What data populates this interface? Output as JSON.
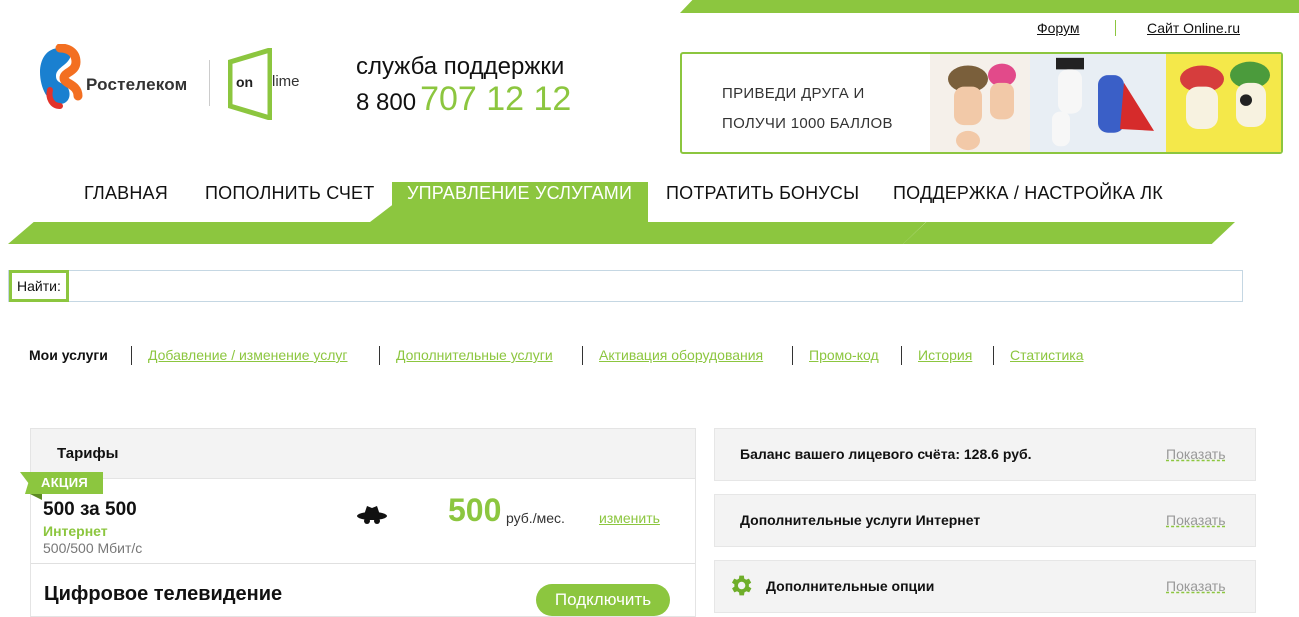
{
  "header": {
    "links": [
      "Форум",
      "Сайт Online.ru"
    ],
    "brand": "Ростелеком",
    "brand2_on": "on",
    "brand2_lime": "lime",
    "support_label": "служба поддержки",
    "phone_prefix": "8 800",
    "phone_main": "707 12 12"
  },
  "banner": {
    "line1": "ПРИВЕДИ ДРУГА И",
    "line2": "ПОЛУЧИ 1000 БАЛЛОВ"
  },
  "nav": {
    "items": [
      "ГЛАВНАЯ",
      "ПОПОЛНИТЬ СЧЕТ",
      "УПРАВЛЕНИЕ УСЛУГАМИ",
      "ПОТРАТИТЬ БОНУСЫ",
      "ПОДДЕРЖКА / НАСТРОЙКА ЛК"
    ],
    "active_index": 2
  },
  "search": {
    "label": "Найти:",
    "value": ""
  },
  "tabs": [
    "Мои услуги",
    "Добавление / изменение услуг",
    "Дополнительные услуги",
    "Активация оборудования",
    "Промо-код",
    "История",
    "Статистика"
  ],
  "tariffs": {
    "title": "Тарифы",
    "badge": "АКЦИЯ",
    "plan_name": "500 за 500",
    "plan_type": "Интернет",
    "plan_speed": "500/500 Мбит/с",
    "price": "500",
    "price_unit": "руб./мес.",
    "change_label": "изменить",
    "tv_title": "Цифровое телевидение",
    "connect_label": "Подключить"
  },
  "panels": [
    {
      "title": "Баланс вашего лицевого счёта: 128.6 руб.",
      "action": "Показать"
    },
    {
      "title": "Дополнительные услуги Интернет",
      "action": "Показать"
    },
    {
      "title": "Дополнительные опции",
      "action": "Показать",
      "icon": "gear-icon"
    }
  ],
  "colors": {
    "accent": "#8cc63f",
    "accent_dark": "#5c8a22",
    "text": "#111111",
    "muted": "#777777"
  }
}
